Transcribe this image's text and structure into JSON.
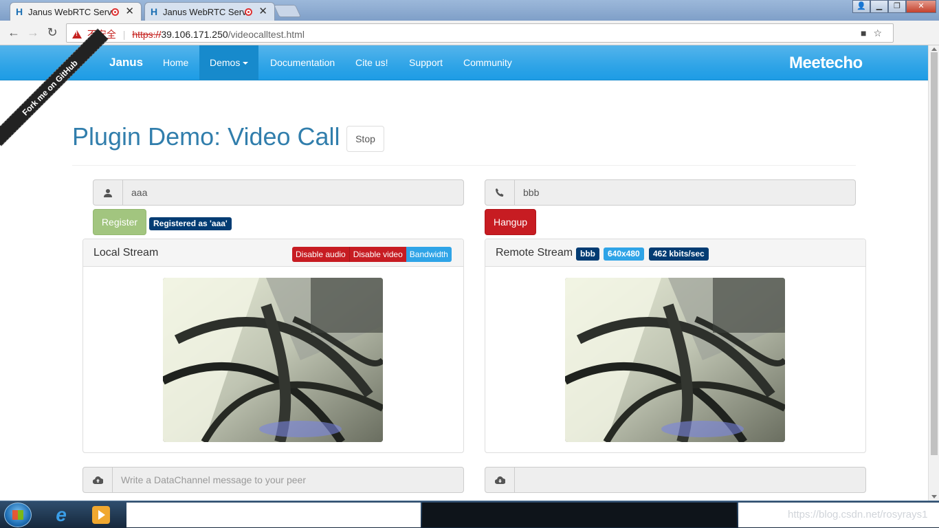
{
  "browser": {
    "tabs": [
      {
        "title": "Janus WebRTC Serv",
        "active": true
      },
      {
        "title": "Janus WebRTC Serv",
        "active": false
      }
    ],
    "address": {
      "security_label": "不安全",
      "scheme": "https://",
      "host": "39.106.171.250",
      "path": "/videocalltest.html"
    }
  },
  "navbar": {
    "brand": "Janus",
    "items": [
      "Home",
      "Demos",
      "Documentation",
      "Cite us!",
      "Support",
      "Community"
    ],
    "active_item": "Demos",
    "logo": "Meetecho",
    "ribbon": "Fork me on GitHub",
    "accent": "#2fa4e7"
  },
  "page": {
    "title": "Plugin Demo: Video Call",
    "stop_label": "Stop",
    "username_value": "aaa",
    "peer_value": "bbb",
    "register_label": "Register",
    "registered_badge": "Registered as 'aaa'",
    "hangup_label": "Hangup",
    "local": {
      "title": "Local Stream",
      "disable_audio": "Disable audio",
      "disable_video": "Disable video",
      "bandwidth": "Bandwidth"
    },
    "remote": {
      "title": "Remote Stream",
      "peer_badge": "bbb",
      "resolution_badge": "640x480",
      "bitrate_badge": "462 kbits/sec"
    },
    "datachannel_placeholder": "Write a DataChannel message to your peer",
    "datachannel_remote_value": ""
  },
  "taskbar": {
    "watermark": "https://blog.csdn.net/rosyrays1"
  }
}
